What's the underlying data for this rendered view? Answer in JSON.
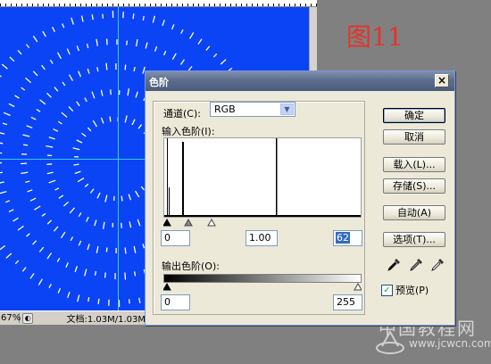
{
  "figure_label": "图11",
  "status_bar": {
    "zoom": "67%",
    "doc_info": "文档:1.03M/1.03M"
  },
  "watermark": {
    "text": "中国教程网",
    "url": "www.jcwcn.com"
  },
  "dialog": {
    "title": "色阶",
    "channel": {
      "label": "通道(C):",
      "value": "RGB"
    },
    "input_levels": {
      "label": "输入色阶(I):",
      "black": "0",
      "gamma": "1.00",
      "white": "62"
    },
    "output_levels": {
      "label": "输出色阶(O):",
      "black": "0",
      "white": "255"
    },
    "buttons": {
      "ok": "确定",
      "cancel": "取消",
      "load": "载入(L)...",
      "save": "存储(S)...",
      "auto": "自动(A)",
      "options": "选项(T)..."
    },
    "preview": {
      "label": "预览(P)",
      "checked": true
    },
    "close": "×"
  },
  "icons": {
    "close": "close-icon",
    "dropdown": "chevron-down-icon",
    "black_eyedropper": "black-eyedropper-icon",
    "gray_eyedropper": "gray-eyedropper-icon",
    "white_eyedropper": "white-eyedropper-icon",
    "checkbox": "checkmark-icon"
  },
  "colors": {
    "canvas": "#0b44f5",
    "guide": "#35c8ff",
    "figure_label": "#e5332a",
    "titlebar": "#5d6d8d"
  }
}
